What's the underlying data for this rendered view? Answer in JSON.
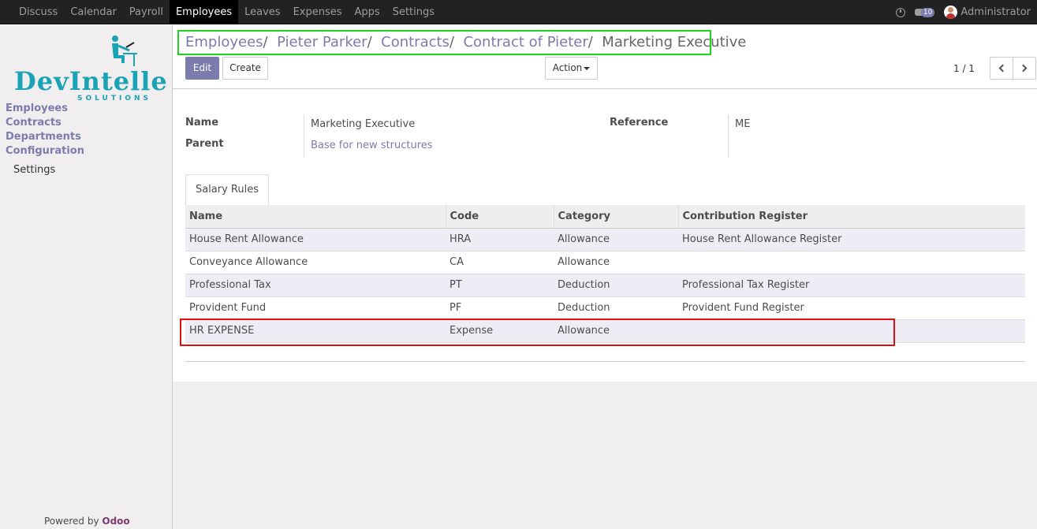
{
  "topbar": {
    "menu": [
      "Discuss",
      "Calendar",
      "Payroll",
      "Employees",
      "Leaves",
      "Expenses",
      "Apps",
      "Settings"
    ],
    "chat_count": "10",
    "user": "Administrator"
  },
  "sidebar": {
    "logo_text": "DevIntelle",
    "logo_sub": "SOLUTIONS",
    "items": [
      "Employees",
      "Contracts",
      "Departments",
      "Configuration"
    ],
    "sub_items": [
      "Settings"
    ],
    "powered_prefix": "Powered by",
    "powered_brand": "Odoo"
  },
  "breadcrumb": {
    "items": [
      "Employees",
      "Pieter Parker",
      "Contracts",
      "Contract of Pieter"
    ],
    "active": "Marketing Executive",
    "separator": "/"
  },
  "buttons": {
    "edit": "Edit",
    "create": "Create",
    "action": "Action"
  },
  "pager": {
    "text": "1 / 1"
  },
  "form": {
    "name_label": "Name",
    "name_value": "Marketing Executive",
    "parent_label": "Parent",
    "parent_value": "Base for new structures",
    "reference_label": "Reference",
    "reference_value": "ME"
  },
  "tab": {
    "label": "Salary Rules"
  },
  "table": {
    "headers": [
      "Name",
      "Code",
      "Category",
      "Contribution Register"
    ],
    "rows": [
      [
        "House Rent Allowance",
        "HRA",
        "Allowance",
        "House Rent Allowance Register"
      ],
      [
        "Conveyance Allowance",
        "CA",
        "Allowance",
        ""
      ],
      [
        "Professional Tax",
        "PT",
        "Deduction",
        "Professional Tax Register"
      ],
      [
        "Provident Fund",
        "PF",
        "Deduction",
        "Provident Fund Register"
      ],
      [
        "HR EXPENSE",
        "Expense",
        "Allowance",
        ""
      ]
    ]
  },
  "colors": {
    "accent": "#7c7bad",
    "highlight_green": "#1ed41e",
    "highlight_red": "#e01010",
    "logo": "#1aa3b5"
  }
}
